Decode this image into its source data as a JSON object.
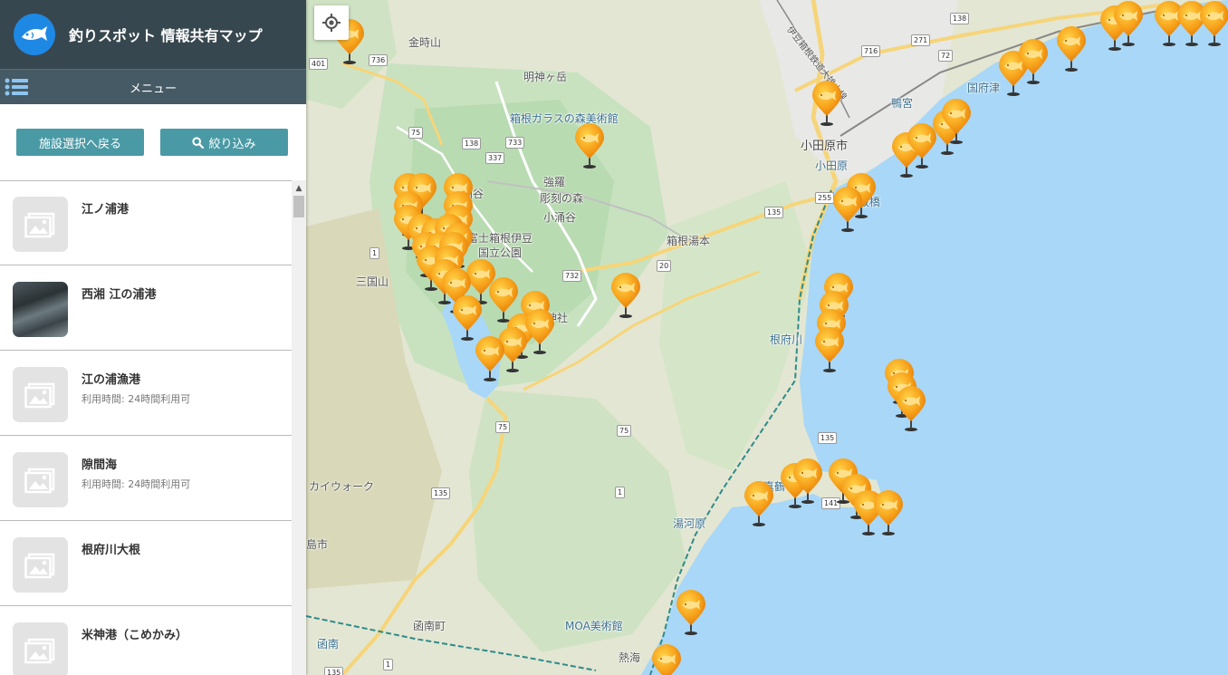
{
  "app": {
    "title": "釣りスポット 情報共有マップ"
  },
  "menu": {
    "label": "メニュー"
  },
  "buttons": {
    "back_label": "施設選択へ戻る",
    "filter_label": "絞り込み"
  },
  "spots": [
    {
      "name": "江ノ浦港",
      "sub": "",
      "has_photo": false
    },
    {
      "name": "西湘 江の浦港",
      "sub": "",
      "has_photo": true
    },
    {
      "name": "江の浦漁港",
      "sub": "利用時間: 24時間利用可",
      "has_photo": false
    },
    {
      "name": "隙間海",
      "sub": "利用時間: 24時間利用可",
      "has_photo": false
    },
    {
      "name": "根府川大根",
      "sub": "",
      "has_photo": false
    },
    {
      "name": "米神港（こめかみ）",
      "sub": "",
      "has_photo": false
    }
  ],
  "map": {
    "place_labels": {
      "kintokisan": "金時山",
      "myojingatake": "明神ヶ岳",
      "hakone_glass": "箱根ガラスの森美術館",
      "owakudani": "大涌谷",
      "gora": "強羅",
      "chokoku": "彫刻の森",
      "kowakidani": "小涌谷",
      "park": "富士箱根伊豆\n国立公園",
      "mikuniyama": "三国山",
      "hakone_shrine": "根神社",
      "hakone_yumoto": "箱根湯本",
      "odawara_city": "小田原市",
      "odawara_st": "小田原",
      "itabashi": "板橋",
      "kamonomiya": "鴨宮",
      "kozu": "国府津",
      "nebukawa": "根府川",
      "manazuru": "真鶴",
      "yugawara": "湯河原",
      "kaiwalk": "カイウォーク",
      "moa": "MOA美術館",
      "kannami": "函南町",
      "kannami_st": "函南",
      "atami": "熱海",
      "mishima": "島市",
      "railway": "伊豆箱根鉄道大雄山線"
    },
    "route_numbers": [
      "401",
      "736",
      "75",
      "138",
      "733",
      "337",
      "1",
      "732",
      "20",
      "75",
      "75",
      "1",
      "135",
      "255",
      "716",
      "271",
      "72",
      "138",
      "135",
      "135",
      "141",
      "135",
      "1"
    ]
  }
}
